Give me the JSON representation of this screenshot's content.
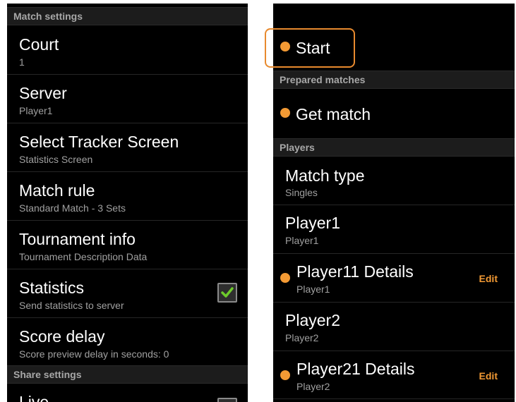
{
  "left": {
    "match_settings_header": "Match settings",
    "court": {
      "title": "Court",
      "value": "1"
    },
    "server": {
      "title": "Server",
      "value": "Player1"
    },
    "tracker": {
      "title": "Select Tracker Screen",
      "value": "Statistics Screen"
    },
    "match_rule": {
      "title": "Match rule",
      "value": "Standard Match - 3 Sets"
    },
    "tournament": {
      "title": "Tournament info",
      "value": "Tournament Description Data"
    },
    "statistics": {
      "title": "Statistics",
      "value": "Send statistics to server",
      "checked": true
    },
    "score_delay": {
      "title": "Score delay",
      "value": "Score preview delay in seconds: 0"
    },
    "share_settings_header": "Share settings",
    "live": {
      "title": "Live",
      "checked": false
    }
  },
  "right": {
    "start_label": "Start",
    "prepared_matches_header": "Prepared matches",
    "get_match_label": "Get match",
    "players_header": "Players",
    "match_type": {
      "title": "Match type",
      "value": "Singles"
    },
    "player1": {
      "title": "Player1",
      "value": "Player1"
    },
    "player11_details": {
      "title": "Player11 Details",
      "value": "Player1",
      "edit_label": "Edit"
    },
    "player2": {
      "title": "Player2",
      "value": "Player2"
    },
    "player21_details": {
      "title": "Player21 Details",
      "value": "Player2",
      "edit_label": "Edit"
    }
  },
  "colors": {
    "accent": "#f39a34",
    "highlight_border": "#e88a2e",
    "checkmark": "#6ecb2b"
  }
}
